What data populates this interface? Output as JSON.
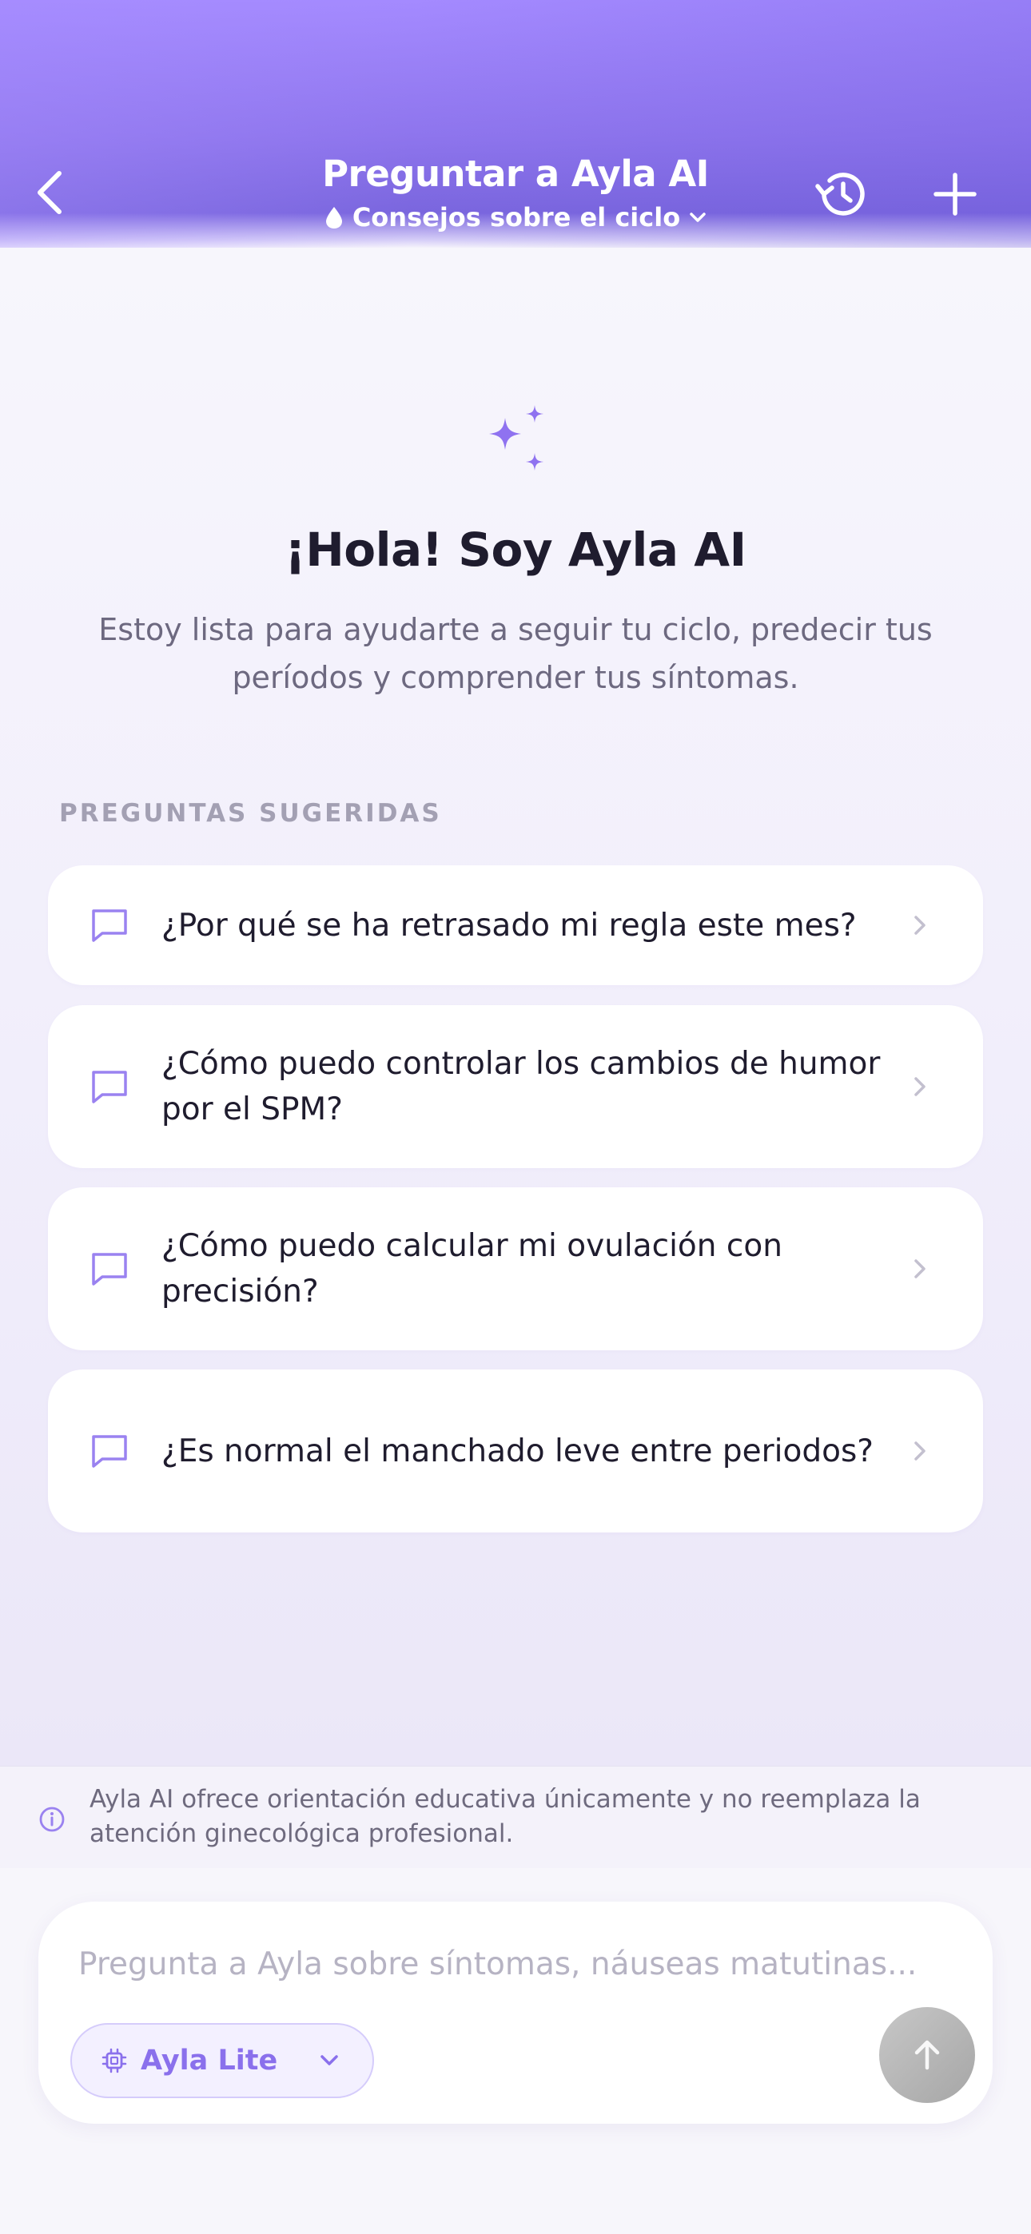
{
  "header": {
    "title": "Preguntar a Ayla AI",
    "subtitle": "Consejos sobre el ciclo"
  },
  "hero": {
    "heading": "¡Hola! Soy Ayla AI",
    "intro": "Estoy lista para ayudarte a seguir tu ciclo, predecir tus períodos y comprender tus síntomas."
  },
  "suggestions": {
    "label": "PREGUNTAS SUGERIDAS",
    "items": [
      "¿Por qué se ha retrasado mi regla este mes?",
      "¿Cómo puedo controlar los cambios de humor por el SPM?",
      "¿Cómo puedo calcular mi ovulación con precisión?",
      "¿Es normal el manchado leve entre periodos?"
    ]
  },
  "disclaimer": "Ayla AI ofrece orientación educativa únicamente y no reemplaza la atención ginecológica profesional.",
  "composer": {
    "placeholder": "Pregunta a Ayla sobre síntomas, náuseas matutinas...",
    "model": "Ayla Lite"
  },
  "icons": {
    "back": "chevron-left-icon",
    "history": "history-icon",
    "new_chat": "plus-icon",
    "subtitle": "drop-icon",
    "hero": "sparkles-icon",
    "suggestion": "chat-bubble-icon",
    "suggestion_arrow": "chevron-right-icon",
    "info": "info-icon",
    "model": "chip-icon",
    "send": "arrow-up-icon"
  },
  "colors": {
    "accent": "#8a70ec",
    "header_start": "#a48aff",
    "header_end": "#7a66de",
    "send_disabled": "#b3b3b3"
  }
}
